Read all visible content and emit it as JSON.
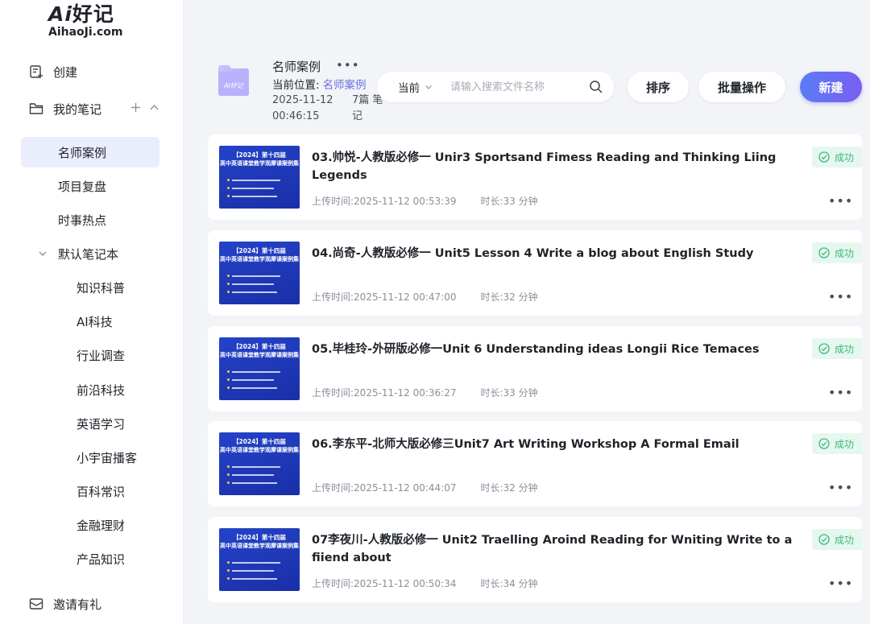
{
  "brand": {
    "logo_top": "好记",
    "logo_ai": "Ai",
    "logo_bottom": "AihaoJi.com"
  },
  "nav": {
    "create": "创建",
    "my_notes": "我的笔记",
    "add_symbol": "+",
    "collapse_symbol": "^",
    "invite": "邀请有礼"
  },
  "folders": [
    {
      "label": "名师案例",
      "active": true
    },
    {
      "label": "项目复盘"
    },
    {
      "label": "时事热点"
    }
  ],
  "default_notebook": {
    "label": "默认笔记本",
    "items": [
      "知识科普",
      "AI科技",
      "行业调查",
      "前沿科技",
      "英语学习",
      "小宇宙播客",
      "百科常识",
      "金融理财",
      "产品知识"
    ]
  },
  "header": {
    "title": "名师案例",
    "more": "•••",
    "location_label": "当前位置:",
    "location_link": "名师案例",
    "date": "2025-11-12 00:46:15",
    "count": "7篇 笔记"
  },
  "search": {
    "scope": "当前",
    "placeholder": "请输入搜索文件名称"
  },
  "toolbar": {
    "sort": "排序",
    "batch": "批量操作",
    "new": "新建"
  },
  "thumbnail": {
    "line1": "【2024】第十四届",
    "line2": "高中英语课堂教学观摩课案例集"
  },
  "notes": [
    {
      "title": "03.帅悦-人教版必修一 Unir3 Sportsand Fimess Reading and Thinking Liing Legends",
      "upload": "上传时间:2025-11-12 00:53:39",
      "duration": "时长:33 分钟",
      "status": "成功"
    },
    {
      "title": "04.尚奇-人教版必修一 Unit5 Lesson 4 Write a blog about English Study",
      "upload": "上传时间:2025-11-12 00:47:00",
      "duration": "时长:32 分钟",
      "status": "成功"
    },
    {
      "title": "05.毕桂玲-外研版必修一Unit 6 Understanding ideas Longii Rice Temaces",
      "upload": "上传时间:2025-11-12 00:36:27",
      "duration": "时长:33 分钟",
      "status": "成功"
    },
    {
      "title": "06.李东平-北师大版必修三Unit7 Art Writing Workshop A Formal Email",
      "upload": "上传时间:2025-11-12 00:44:07",
      "duration": "时长:32 分钟",
      "status": "成功"
    },
    {
      "title": "07李夜川-人教版必修一 Unit2 Traelling Aroind Reading for Wniting Write to a fiiend about",
      "upload": "上传时间:2025-11-12 00:50:34",
      "duration": "时长:34 分钟",
      "status": "成功"
    }
  ],
  "card_more": "•••",
  "colors": {
    "accent": "#6b6fe0",
    "success": "#3db77b",
    "active_bg": "#eaedfb"
  }
}
